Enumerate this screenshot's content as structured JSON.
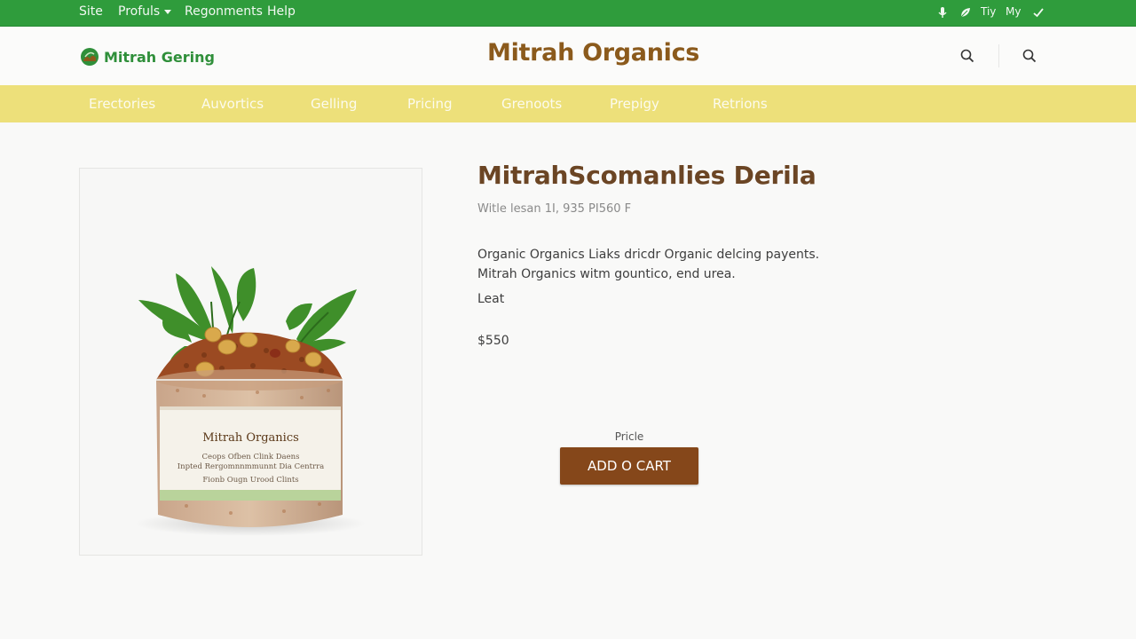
{
  "colors": {
    "topbar": "#2f9c3c",
    "category_bar": "#ede07a",
    "brand_title": "#8b5a1c",
    "button": "#85471a"
  },
  "topbar": {
    "links": [
      {
        "label": "Site",
        "icon": ""
      },
      {
        "label": "Profuls",
        "icon": "chevron-down-icon"
      },
      {
        "label": "Regonments",
        "icon": ""
      },
      {
        "label": "Help",
        "icon": ""
      }
    ],
    "right": {
      "icons": [
        "microphone-icon",
        "leaf-icon"
      ],
      "text_1": "Tiy",
      "text_2": "My",
      "check_icon": "check-icon"
    }
  },
  "header": {
    "logo_text": "Mitrah Gering",
    "logo_icon": "leaf-logo-icon",
    "title": "Mitrah Organics",
    "icons": [
      "search-icon",
      "search-icon"
    ]
  },
  "categories": [
    "Erectories",
    "Auvortics",
    "Gelling",
    "Pricing",
    "Grenoots",
    "Prepigy",
    "Retrions"
  ],
  "product": {
    "image_label": {
      "brand": "Mitrah Organics",
      "line_1": "Ceops Ofben Clink Daens",
      "line_2": "Inpted Rergomnnmmunnt Dia Centrra",
      "line_3": "Fionb Ougn Urood Clints"
    },
    "name": "MitrahScomanlies Derila",
    "meta": "Witle lesan 1I, 935 PI560 F",
    "description_1": "Organic Organics Liaks dricdr Organic delcing payents.",
    "description_2": "Mitrah Organics witm gountico, end urea.",
    "label": "Leat",
    "price": "$550",
    "price_caption": "Pricle",
    "add_to_cart": "ADD O CART"
  }
}
